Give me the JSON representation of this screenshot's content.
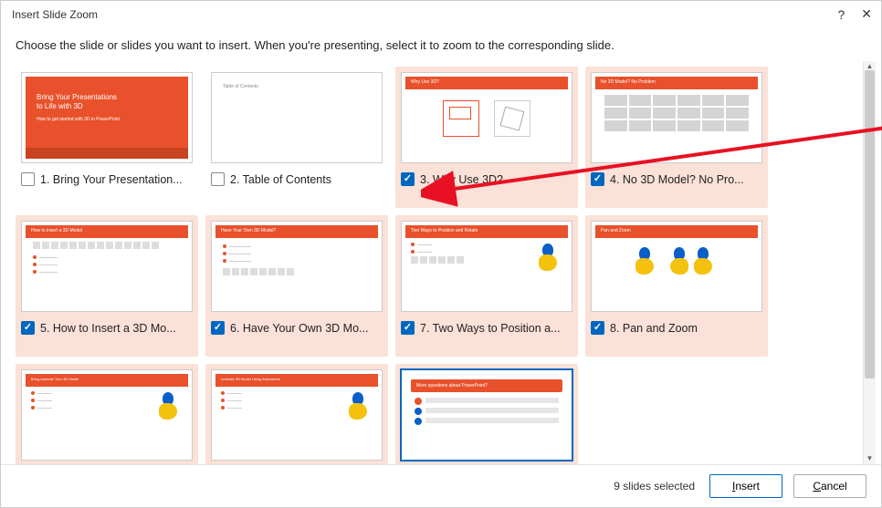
{
  "titlebar": {
    "title": "Insert Slide Zoom"
  },
  "instruction": "Choose the slide or slides you want to insert. When you're presenting, select it to zoom to the corresponding slide.",
  "slides": [
    {
      "label": "1. Bring Your Presentation...",
      "checked": false
    },
    {
      "label": "2. Table of Contents",
      "checked": false
    },
    {
      "label": "3. Why Use 3D?",
      "checked": true
    },
    {
      "label": "4. No 3D Model? No Pro...",
      "checked": true
    },
    {
      "label": "5. How to Insert a 3D Mo...",
      "checked": true
    },
    {
      "label": "6. Have Your Own 3D Mo...",
      "checked": true
    },
    {
      "label": "7. Two Ways to Position a...",
      "checked": true
    },
    {
      "label": "8. Pan and Zoom",
      "checked": true
    },
    {
      "label": "",
      "checked": false
    },
    {
      "label": "",
      "checked": false
    },
    {
      "label": "",
      "checked": false
    }
  ],
  "thumb_texts": {
    "s1_title": "Bring Your Presentations\nto Life with 3D",
    "s1_sub": "How to get started with 3D in PowerPoint",
    "s11_title": "More questions about PowerPoint?"
  },
  "footer": {
    "status": "9 slides selected",
    "insert": "Insert",
    "cancel": "Cancel"
  }
}
